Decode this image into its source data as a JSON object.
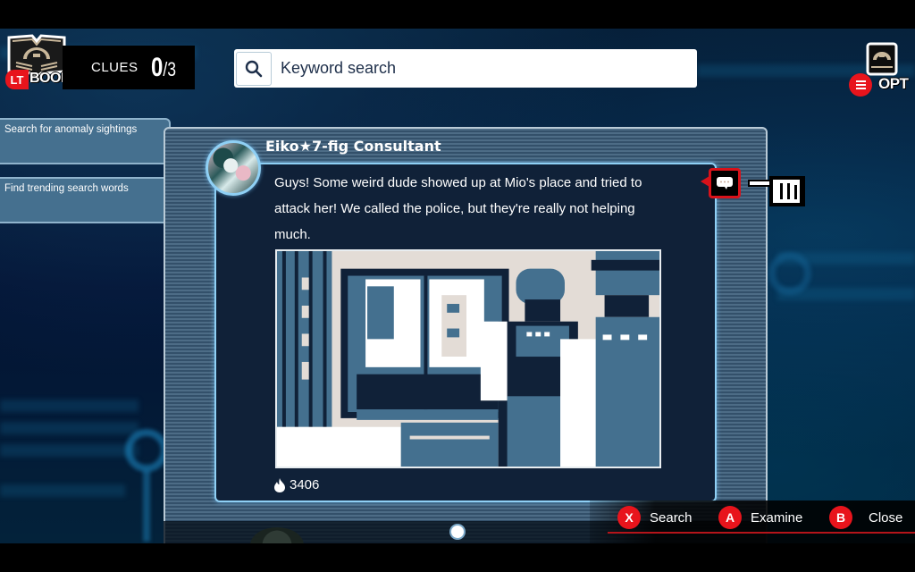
{
  "hud": {
    "book_button": {
      "badge": "LT",
      "label": "BOOK"
    },
    "clues": {
      "label": "CLUES",
      "found": "0",
      "total": "/3"
    },
    "search": {
      "placeholder": "Keyword search",
      "value": ""
    },
    "options_button": {
      "label": "OPT"
    }
  },
  "side_tabs": [
    {
      "label": "Search for anomaly sightings"
    },
    {
      "label": "Find trending search words"
    }
  ],
  "post": {
    "author": "Eiko★7-fig Consultant",
    "text": "Guys! Some weird dude showed up at Mio's place and tried to attack her! We called the police, but they're really not helping much.",
    "image_description": "Pixel-art illustration of two police officers standing in a doorway",
    "likes": "3406"
  },
  "controls": [
    {
      "button": "X",
      "label": "Search"
    },
    {
      "button": "A",
      "label": "Examine"
    },
    {
      "button": "B",
      "label": "Close"
    }
  ],
  "colors": {
    "accent_red": "#e8141c",
    "card_bg": "#102138",
    "card_border": "#8fd0f5",
    "tab_bg": "#45708f"
  }
}
